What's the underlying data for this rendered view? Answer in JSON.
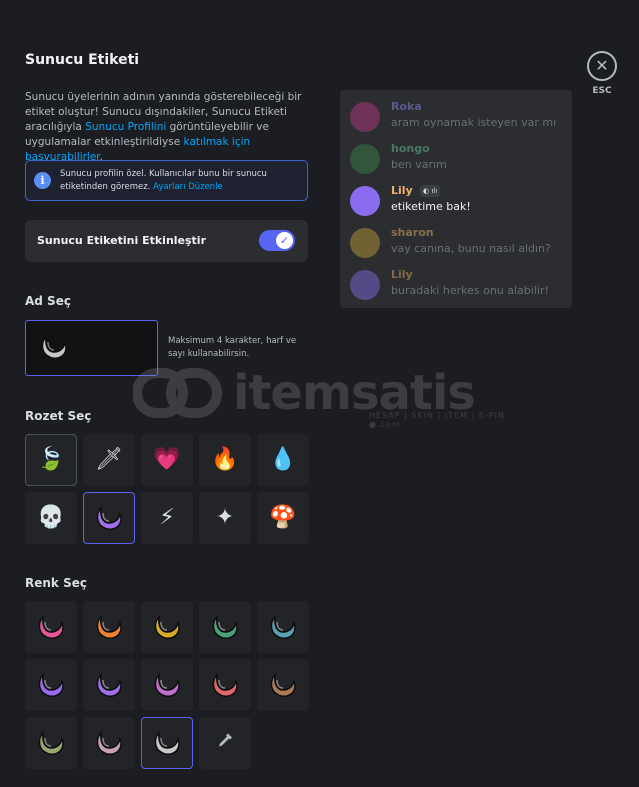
{
  "title": "Sunucu Etiketi",
  "close": {
    "glyph": "✕",
    "esc_label": "ESC"
  },
  "description": {
    "part1": "Sunucu üyelerinin adının yanında gösterebileceği bir etiket oluştur! Sunucu dışındakiler, Sunucu Etiketi aracılığıyla ",
    "link1": "Sunucu Profilini",
    "part2": " görüntüleyebilir ve uygulamalar etkinleştirildiyse ",
    "link2": "katılmak için başvurabilirler",
    "part3": "."
  },
  "info": {
    "icon": "i",
    "text": "Sunucu profilin özel. Kullanıcılar bunu bir sunucu etiketinden göremez. ",
    "link": "Ayarları Düzenle"
  },
  "toggle": {
    "label": "Sunucu Etiketini Etkinleştir",
    "checked": true,
    "check_glyph": "✓"
  },
  "name_section": {
    "title": "Ad Seç",
    "hint": "Maksimum 4 karakter, harf ve sayı kullanabilirsin.",
    "icon": "crescent-moon-icon"
  },
  "badge_section": {
    "title": "Rozet Seç",
    "badges": [
      {
        "name": "leaf",
        "glyph": "🍃"
      },
      {
        "name": "sword",
        "glyph": "🗡"
      },
      {
        "name": "heart",
        "glyph": "💗"
      },
      {
        "name": "fire",
        "glyph": "🔥"
      },
      {
        "name": "water-drop",
        "glyph": "💧"
      },
      {
        "name": "skull",
        "glyph": "💀"
      },
      {
        "name": "crescent-moon",
        "glyph": ""
      },
      {
        "name": "lightning",
        "glyph": "⚡"
      },
      {
        "name": "crystal",
        "glyph": "✦"
      },
      {
        "name": "mushroom",
        "glyph": "🍄"
      }
    ],
    "selected": "crescent-moon",
    "highlighted": "leaf"
  },
  "color_section": {
    "title": "Renk Seç",
    "colors": [
      "#e8559a",
      "#f0822e",
      "#d8aa2a",
      "#4aa37a",
      "#5aa0b2",
      "#9a6af0",
      "#a070e8",
      "#c070c8",
      "#e06868",
      "#b07a55",
      "#9aa870",
      "#c8a0b0",
      "#c8c8c8"
    ],
    "selected_index": 12,
    "custom_icon": "eyedropper-icon"
  },
  "chat": {
    "messages": [
      {
        "user": "Roka",
        "text": "aram oynamak isteyen var mı",
        "color": "#8e94f2",
        "avatar": "#c0398a",
        "dim": true
      },
      {
        "user": "hongo",
        "text": "ben varım",
        "color": "#6fd19a",
        "avatar": "#3a8a4a",
        "dim": true
      },
      {
        "user": "Lily",
        "text": "etiketime bak!",
        "color": "#f0b06a",
        "avatar": "#8a6cf0",
        "dim": false,
        "tag": "◐ ılı"
      },
      {
        "user": "sharon",
        "text": "vay canına, bunu nasıl aldın?",
        "color": "#f5c26b",
        "avatar": "#c8a43a",
        "dim": true
      },
      {
        "user": "Lily",
        "text": "buradaki herkes onu alabilir!",
        "color": "#f0b06a",
        "avatar": "#8a6cf0",
        "dim": true
      }
    ]
  },
  "watermark": {
    "text": "itemsatis",
    "sub": "HESAP | SKIN | ITEM | E-PIN ●.com"
  }
}
